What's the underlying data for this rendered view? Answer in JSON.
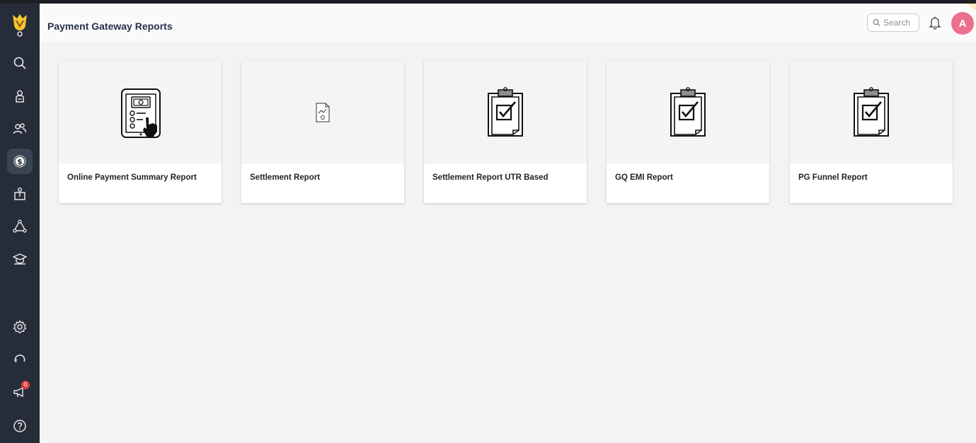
{
  "header": {
    "title": "Payment Gateway Reports",
    "search_placeholder": "Search",
    "avatar_initial": "A"
  },
  "sidebar": {
    "items": [
      {
        "name": "search",
        "icon": "search-icon"
      },
      {
        "name": "onboarding",
        "icon": "person-badge-icon"
      },
      {
        "name": "users",
        "icon": "users-icon"
      },
      {
        "name": "payments",
        "icon": "dollar-coin-icon",
        "active": true
      },
      {
        "name": "admission",
        "icon": "person-board-icon"
      },
      {
        "name": "network",
        "icon": "network-icon"
      },
      {
        "name": "academics",
        "icon": "graduation-cap-icon"
      },
      {
        "name": "settings",
        "icon": "gear-icon"
      },
      {
        "name": "refresh",
        "icon": "refresh-icon"
      },
      {
        "name": "announcements",
        "icon": "megaphone-icon",
        "badge": "0"
      },
      {
        "name": "help",
        "icon": "help-icon"
      }
    ]
  },
  "cards": [
    {
      "label": "Online Payment Summary Report",
      "icon": "tablet-payment-icon"
    },
    {
      "label": "Settlement Report",
      "icon": "document-chart-icon"
    },
    {
      "label": "Settlement Report UTR Based",
      "icon": "clipboard-check-icon"
    },
    {
      "label": "GQ EMI Report",
      "icon": "clipboard-check-icon"
    },
    {
      "label": "PG Funnel Report",
      "icon": "clipboard-check-icon"
    }
  ],
  "colors": {
    "sidebar": "#262d38",
    "avatar": "#ec6f8d",
    "badge": "#e0413a",
    "accent_yellow": "#f6c531"
  }
}
